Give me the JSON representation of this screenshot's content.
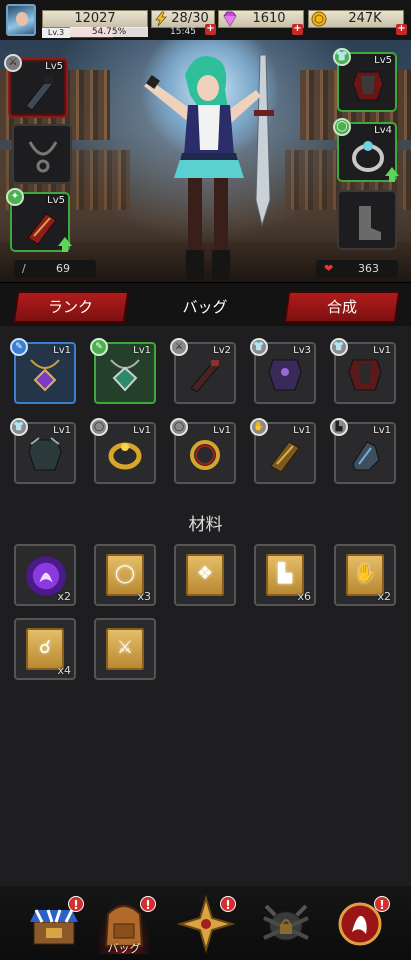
{
  "header": {
    "power": "12027",
    "level": "Lv.3",
    "exp_percent": "54.75%",
    "exp_fraction": 0.5475,
    "stamina": "28/30",
    "stamina_timer": "15:45",
    "gems": "1610",
    "gold": "247K"
  },
  "equipment": {
    "slots": [
      {
        "name": "weapon",
        "level": "Lv5",
        "state": "equipped"
      },
      {
        "name": "necklace",
        "level": "",
        "state": "empty"
      },
      {
        "name": "gauntlet",
        "level": "Lv5",
        "state": "upgradeable"
      },
      {
        "name": "armor",
        "level": "Lv5",
        "state": "equipped"
      },
      {
        "name": "ring",
        "level": "Lv4",
        "state": "upgradeable"
      },
      {
        "name": "boots",
        "level": "",
        "state": "empty"
      }
    ],
    "attack": "69",
    "hp": "363"
  },
  "tabs": {
    "rank": "ランク",
    "bag": "バッグ",
    "synthesis": "合成"
  },
  "inventory": {
    "items": [
      {
        "level": "Lv1",
        "kind": "necklace",
        "rarity": "blue"
      },
      {
        "level": "Lv1",
        "kind": "necklace",
        "rarity": "green"
      },
      {
        "level": "Lv2",
        "kind": "weapon",
        "rarity": "gray"
      },
      {
        "level": "Lv3",
        "kind": "armor",
        "rarity": "gray"
      },
      {
        "level": "Lv1",
        "kind": "armor",
        "rarity": "gray"
      },
      {
        "level": "Lv1",
        "kind": "armor",
        "rarity": "gray"
      },
      {
        "level": "Lv1",
        "kind": "ring",
        "rarity": "gray"
      },
      {
        "level": "Lv1",
        "kind": "ring",
        "rarity": "gray"
      },
      {
        "level": "Lv1",
        "kind": "gauntlet",
        "rarity": "gray"
      },
      {
        "level": "Lv1",
        "kind": "boots",
        "rarity": "gray"
      }
    ],
    "materials_title": "材料",
    "materials": [
      {
        "kind": "essence",
        "qty": "x2"
      },
      {
        "kind": "ring-scroll",
        "qty": "x3"
      },
      {
        "kind": "armor-scroll",
        "qty": ""
      },
      {
        "kind": "boots-scroll",
        "qty": "x6"
      },
      {
        "kind": "gauntlet-scroll",
        "qty": "x2"
      },
      {
        "kind": "necklace-scroll",
        "qty": "x4"
      },
      {
        "kind": "weapon-scroll",
        "qty": ""
      }
    ]
  },
  "nav": {
    "shop": "",
    "bag": "バッグ",
    "hero": "",
    "locked": "",
    "battle": ""
  },
  "colors": {
    "accent_red": "#b11c1c",
    "rarity_blue": "#3a7fd0",
    "rarity_green": "#3fa83a",
    "upgrade_green": "#5fd35a"
  }
}
